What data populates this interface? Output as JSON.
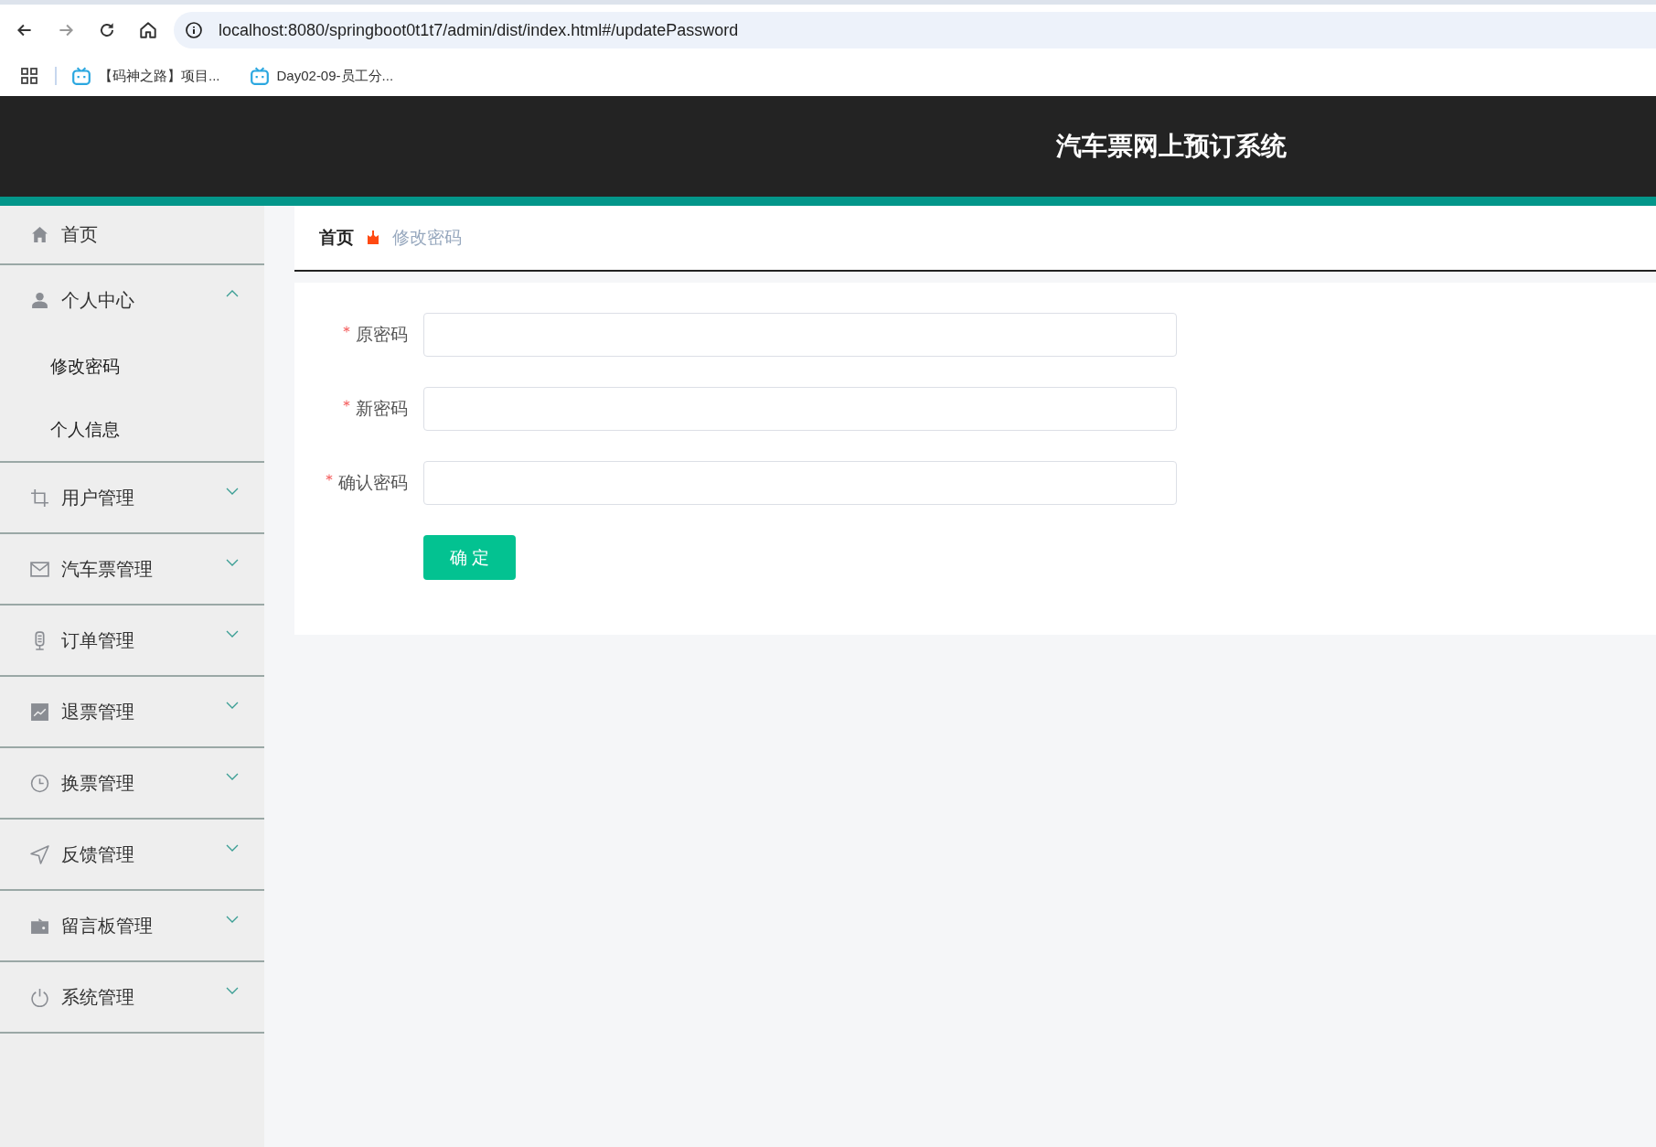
{
  "browser": {
    "url": "localhost:8080/springboot0t1t7/admin/dist/index.html#/updatePassword",
    "bookmarks": [
      "【码神之路】项目...",
      "Day02-09-员工分..."
    ]
  },
  "header": {
    "title": "汽车票网上预订系统"
  },
  "sidebar": {
    "items": [
      {
        "kind": "link",
        "label": "首页"
      },
      {
        "kind": "submenu",
        "label": "个人中心",
        "expanded": true,
        "children": [
          {
            "label": "修改密码"
          },
          {
            "label": "个人信息"
          }
        ]
      },
      {
        "kind": "submenu",
        "label": "用户管理",
        "expanded": false
      },
      {
        "kind": "submenu",
        "label": "汽车票管理",
        "expanded": false
      },
      {
        "kind": "submenu",
        "label": "订单管理",
        "expanded": false
      },
      {
        "kind": "submenu",
        "label": "退票管理",
        "expanded": false
      },
      {
        "kind": "submenu",
        "label": "换票管理",
        "expanded": false
      },
      {
        "kind": "submenu",
        "label": "反馈管理",
        "expanded": false
      },
      {
        "kind": "submenu",
        "label": "留言板管理",
        "expanded": false
      },
      {
        "kind": "submenu",
        "label": "系统管理",
        "expanded": false
      }
    ]
  },
  "breadcrumb": [
    "首页",
    "修改密码"
  ],
  "form": {
    "fields": [
      {
        "label": "原密码",
        "required": true
      },
      {
        "label": "新密码",
        "required": true
      },
      {
        "label": "确认密码",
        "required": true
      }
    ],
    "submit": "确 定"
  }
}
